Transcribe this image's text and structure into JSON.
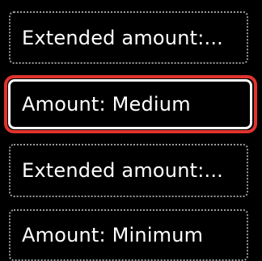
{
  "menu": {
    "items": [
      {
        "label": "Extended amount:...",
        "selected": false
      },
      {
        "label": "Amount: Medium",
        "selected": true
      },
      {
        "label": "Extended amount:...",
        "selected": false
      },
      {
        "label": "Amount: Minimum",
        "selected": false
      }
    ]
  },
  "colors": {
    "background": "#000000",
    "text": "#ffffff",
    "selection_highlight": "#e0332e",
    "selected_border": "#ffffff",
    "item_border": "#9a9a9a"
  }
}
